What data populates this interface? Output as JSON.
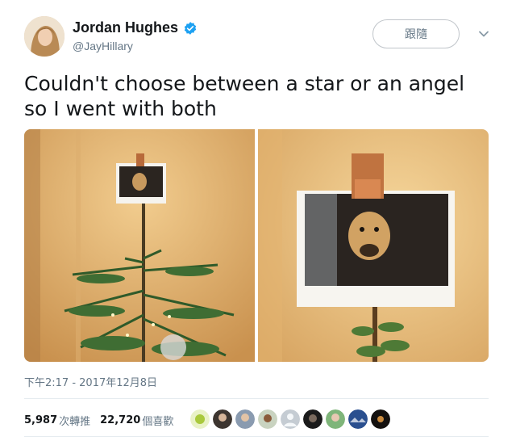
{
  "user": {
    "display_name": "Jordan Hughes",
    "handle": "@JayHillary",
    "verified": true
  },
  "follow_button": {
    "label": "跟隨"
  },
  "tweet": {
    "text": "Couldn't choose between a star or an angel\nso I went with both"
  },
  "timestamp": "下午2:17 - 2017年12月8日",
  "stats": {
    "retweets_count": "5,987",
    "retweets_label": "次轉推",
    "likes_count": "22,720",
    "likes_label": "個喜歡"
  },
  "icons": {
    "verified": "verified-badge-icon",
    "more": "chevron-down-icon"
  },
  "colors": {
    "verified_blue": "#1da1f2",
    "text_primary": "#14171a",
    "text_secondary": "#657786"
  }
}
